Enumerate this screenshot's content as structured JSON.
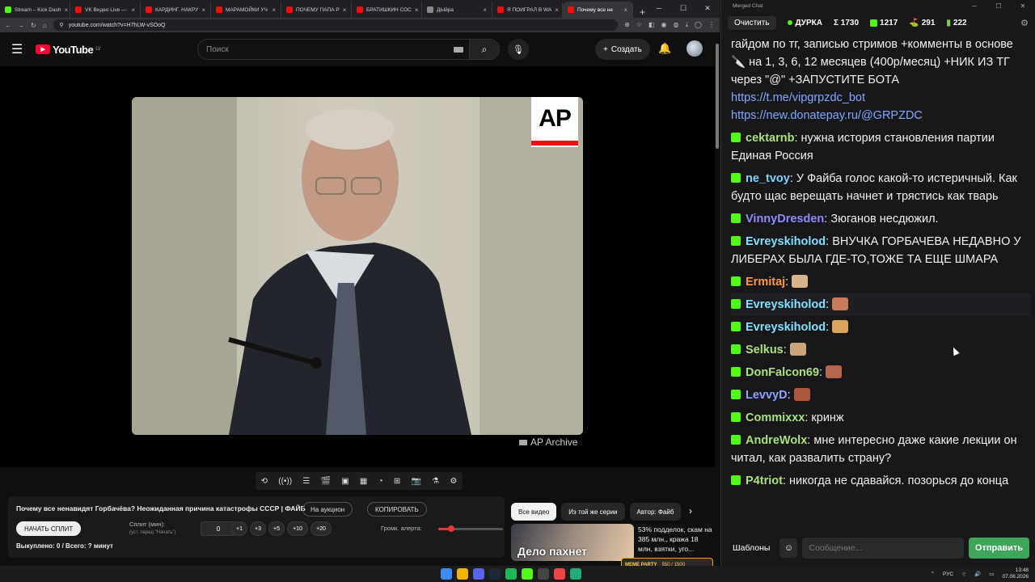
{
  "browser": {
    "tabs": [
      {
        "label": "Stream – Kick Dash",
        "color": "#53fc18"
      },
      {
        "label": "VK Видео Live — ",
        "color": "#e11"
      },
      {
        "label": "КАРДИНГ. НАКРУ",
        "color": "#e11"
      },
      {
        "label": "МАРАМОЙКИ УЧ",
        "color": "#e11"
      },
      {
        "label": "ПОЧЕМУ ПАПА Р",
        "color": "#e11"
      },
      {
        "label": "БРАТИШКИН СОС",
        "color": "#e11"
      },
      {
        "label": "ДЫйра",
        "color": "#888"
      },
      {
        "label": "Я ПОИГРАЛ В WA",
        "color": "#e11"
      },
      {
        "label": "Почему все не",
        "color": "#e11"
      }
    ],
    "url": "youtube.com/watch?v=H7hLW-vSOoQ"
  },
  "youtube": {
    "logo_text": "YouTube",
    "region": "LV",
    "search_placeholder": "Поиск",
    "create_label": "Создать",
    "watermark": "AP Archive",
    "ap_logo": "AP"
  },
  "panel": {
    "title": "Почему все ненавидят Горбачёва? Неожиданная причина катастрофы СССР | ФАЙБ",
    "auction_label": "На аукцион",
    "copy_label": "КОПИРОВАТЬ",
    "split_label": "НАЧАТЬ СПЛИТ",
    "split_min_label": "Сплит (мин):",
    "split_hint": "(уст. перед \"Начать\")",
    "split_value": "0",
    "steps": [
      "+1",
      "+3",
      "+5",
      "+10",
      "+20"
    ],
    "volume_label": "Громк. алерта:",
    "volume_level": 0.2,
    "status": "Выкуплено: 0 / Всего: ? минут"
  },
  "suggestions": {
    "chips": [
      "Все видео",
      "Из той же серии",
      "Автор: Файб"
    ],
    "video_title": "53% подделок, скам на 385 млн., кража 18 млн, взятки, уго...",
    "thumb_text": "Дело пахнет"
  },
  "meme_party": {
    "label": "MEME PARTY",
    "progress": "550 / 1500"
  },
  "chat": {
    "window_title": "Merged Chat",
    "clear_label": "Очистить",
    "channel": "ДУРКА",
    "stats": {
      "sum": "Σ 1730",
      "kick": "1217",
      "vk": "291",
      "tw": "222"
    },
    "messages": [
      {
        "user": "",
        "color": "#efeff1",
        "text": "гайдом по тг, записью стримов +комменты в основе 🔪 на 1, 3, 6, 12 месяцев (400р/месяц) +НИК ИЗ ТГ через \"@\" +ЗАПУСТИТЕ БОТА",
        "links": [
          "https://t.me/vipgrpzdc_bot",
          "https://new.donatepay.ru/@GRPZDC"
        ]
      },
      {
        "user": "cektarnb",
        "color": "#a8e07a",
        "text": "нужна история становления партии Единая Россия"
      },
      {
        "user": "ne_tvoy",
        "color": "#7fd3ff",
        "text": "У Файба голос какой-то истеричный. Как будто щас верещать начнет и трястись как тварь"
      },
      {
        "user": "VinnyDresden",
        "color": "#8e8bff",
        "text": "Зюганов несдюжил."
      },
      {
        "user": "Evreyskiholod",
        "color": "#7fe0ff",
        "text": "ВНУЧКА ГОРБАЧЕВА НЕДАВНО У ЛИБЕРАХ БЫЛА ГДЕ-ТО,ТОЖЕ ТА ЕЩЕ ШМАРА"
      },
      {
        "user": "Ermitaj",
        "color": "#ff9a3c",
        "text": ""
      },
      {
        "user": "Evreyskiholod",
        "color": "#7fe0ff",
        "text": ""
      },
      {
        "user": "Evreyskiholod",
        "color": "#7fe0ff",
        "text": ""
      },
      {
        "user": "Selkus",
        "color": "#a8e07a",
        "text": ""
      },
      {
        "user": "DonFalcon69",
        "color": "#a8e07a",
        "text": ""
      },
      {
        "user": "LevvyD",
        "color": "#8ea2ff",
        "text": ""
      },
      {
        "user": "Commixxx",
        "color": "#a8e07a",
        "text": "кринж"
      },
      {
        "user": "AndreWolx",
        "color": "#a8e07a",
        "text": "мне интересно даже какие лекции он читал, как развалить страну?"
      },
      {
        "user": "P4triot",
        "color": "#a8e07a",
        "text": "никогда не сдавайся. позорься до конца"
      }
    ],
    "templates_label": "Шаблоны",
    "input_placeholder": "Сообщение...",
    "send_label": "Отправить"
  },
  "taskbar": {
    "lang": "РУС",
    "time": "13:48",
    "date": "07.08.2026"
  }
}
